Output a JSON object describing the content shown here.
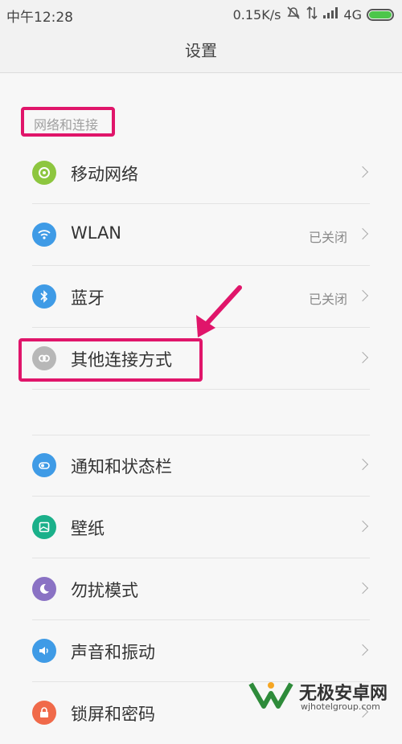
{
  "status_bar": {
    "time": "中午12:28",
    "net_speed": "0.15K/s",
    "network": "4G",
    "icons": [
      "mute-icon",
      "data-arrows-icon",
      "signal-icon",
      "battery-icon"
    ]
  },
  "title_bar": {
    "title": "设置"
  },
  "section": {
    "label": "网络和连接"
  },
  "rows": [
    {
      "label": "移动网络",
      "value": "",
      "icon": "mobile-network-icon",
      "color": "#8dc63f"
    },
    {
      "label": "WLAN",
      "value": "已关闭",
      "icon": "wifi-icon",
      "color": "#3f9be6"
    },
    {
      "label": "蓝牙",
      "value": "已关闭",
      "icon": "bluetooth-icon",
      "color": "#3f9be6"
    },
    {
      "label": "其他连接方式",
      "value": "",
      "icon": "link-icon",
      "color": "#b7b7b7"
    },
    {
      "label": "通知和状态栏",
      "value": "",
      "icon": "notification-icon",
      "color": "#3f9be6"
    },
    {
      "label": "壁纸",
      "value": "",
      "icon": "wallpaper-icon",
      "color": "#1bb08a"
    },
    {
      "label": "勿扰模式",
      "value": "",
      "icon": "moon-icon",
      "color": "#8a72c4"
    },
    {
      "label": "声音和振动",
      "value": "",
      "icon": "sound-icon",
      "color": "#3f9be6"
    },
    {
      "label": "锁屏和密码",
      "value": "",
      "icon": "lock-icon",
      "color": "#f06a4a"
    }
  ],
  "annotation": {
    "color": "#e0156a"
  },
  "watermark": {
    "name": "无极安卓网",
    "url": "wjhotelgroup.com"
  }
}
